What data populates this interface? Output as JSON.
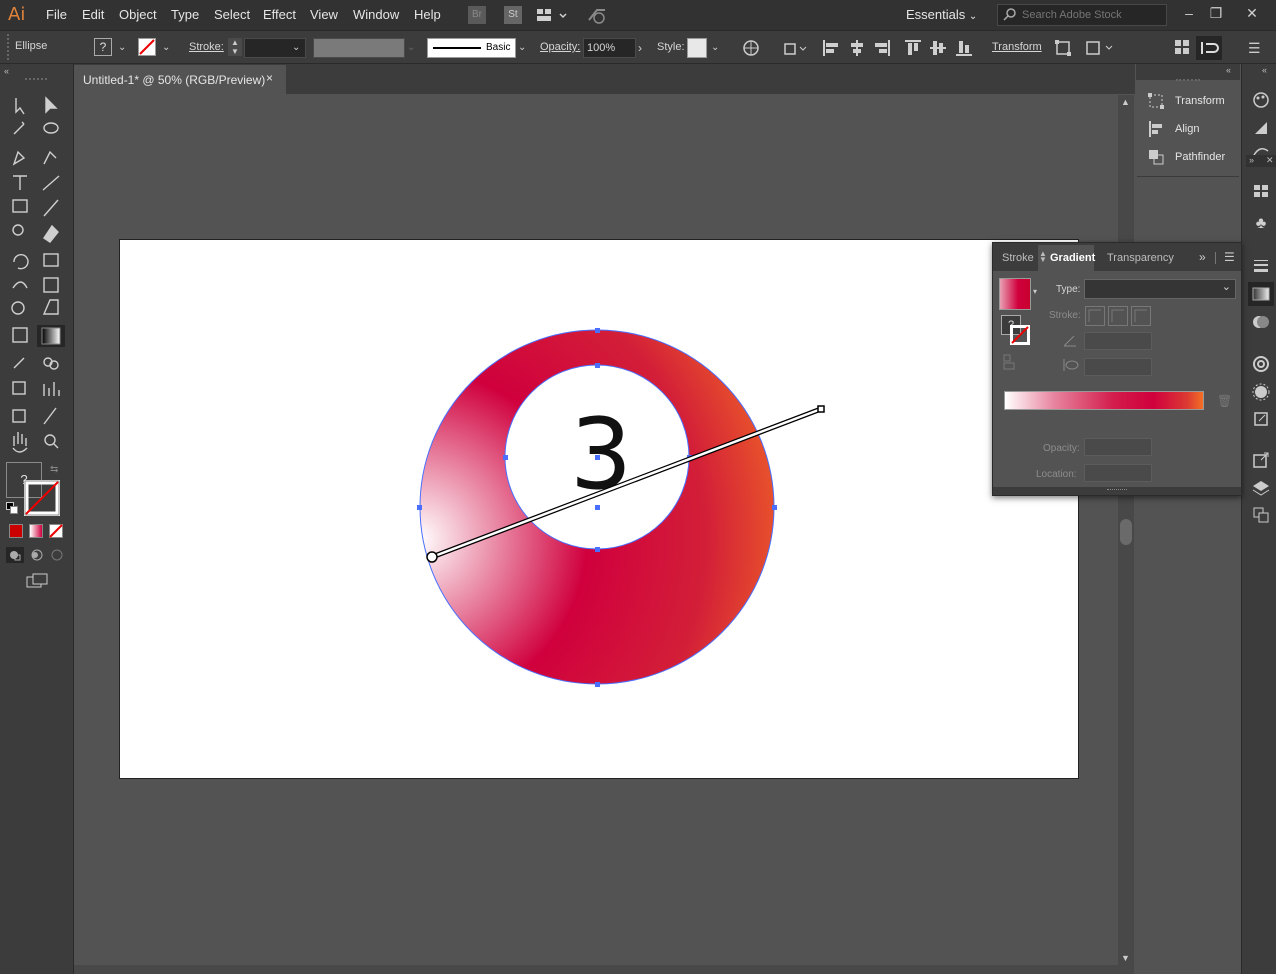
{
  "app": {
    "logo": "Ai",
    "accent": "#e0833a"
  },
  "menu": [
    "File",
    "Edit",
    "Object",
    "Type",
    "Select",
    "Effect",
    "View",
    "Window",
    "Help"
  ],
  "menubar_icons": {
    "bridge": "Br",
    "stock": "St"
  },
  "workspace": "Essentials",
  "stock_search": {
    "placeholder": "Search Adobe Stock"
  },
  "control": {
    "object_type": "Ellipse",
    "stroke_label": "Stroke:",
    "brush_style": "Basic",
    "opacity_label": "Opacity:",
    "opacity_value": "100%",
    "style_label": "Style:",
    "transform_label": "Transform"
  },
  "document": {
    "tab_title": "Untitled-1* @ 50% (RGB/Preview)",
    "close": "×"
  },
  "artwork": {
    "number": "3",
    "gradient_colors": [
      "#ffffff",
      "#d0003d",
      "#f46f24"
    ]
  },
  "panels": {
    "collapsed": [
      "Transform",
      "Align",
      "Pathfinder"
    ],
    "gradient": {
      "tabs": [
        "Stroke",
        "Gradient",
        "Transparency"
      ],
      "active_tab": "Gradient",
      "type_label": "Type:",
      "stroke_label": "Stroke:",
      "opacity_label": "Opacity:",
      "location_label": "Location:"
    }
  },
  "fill_stroke": {
    "fill_none_symbol": "?"
  },
  "colors": {
    "fill_swatch": "#cc0000",
    "ui_dark": "#323232",
    "ui_mid": "#3c3c3c",
    "ui_canvas": "#535353"
  }
}
